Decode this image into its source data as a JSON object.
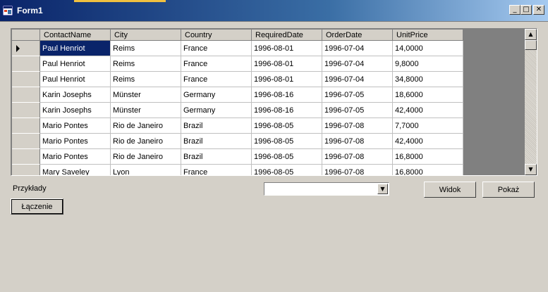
{
  "window": {
    "title": "Form1",
    "controls": {
      "minimize": "_",
      "maximize": "□",
      "close": "✕"
    },
    "icons": {
      "app": "form-app-icon"
    }
  },
  "grid": {
    "columns": [
      "ContactName",
      "City",
      "Country",
      "RequiredDate",
      "OrderDate",
      "UnitPrice"
    ],
    "rows": [
      [
        "Paul Henriot",
        "Reims",
        "France",
        "1996-08-01",
        "1996-07-04",
        "14,0000"
      ],
      [
        "Paul Henriot",
        "Reims",
        "France",
        "1996-08-01",
        "1996-07-04",
        "9,8000"
      ],
      [
        "Paul Henriot",
        "Reims",
        "France",
        "1996-08-01",
        "1996-07-04",
        "34,8000"
      ],
      [
        "Karin Josephs",
        "Münster",
        "Germany",
        "1996-08-16",
        "1996-07-05",
        "18,6000"
      ],
      [
        "Karin Josephs",
        "Münster",
        "Germany",
        "1996-08-16",
        "1996-07-05",
        "42,4000"
      ],
      [
        "Mario Pontes",
        "Rio de Janeiro",
        "Brazil",
        "1996-08-05",
        "1996-07-08",
        "7,7000"
      ],
      [
        "Mario Pontes",
        "Rio de Janeiro",
        "Brazil",
        "1996-08-05",
        "1996-07-08",
        "42,4000"
      ],
      [
        "Mario Pontes",
        "Rio de Janeiro",
        "Brazil",
        "1996-08-05",
        "1996-07-08",
        "16,8000"
      ],
      [
        "Mary Saveley",
        "Lyon",
        "France",
        "1996-08-05",
        "1996-07-08",
        "16,8000"
      ]
    ],
    "current_row_index": 0,
    "selected_cell": {
      "row": 0,
      "column": 0
    }
  },
  "form": {
    "examples_label": "Przykłady",
    "examples_combo_value": "",
    "view_button": "Widok",
    "show_button": "Pokaż",
    "join_button": "Łączenie"
  },
  "colors": {
    "title_gradient_start": "#0a246a",
    "title_gradient_end": "#a6caf0",
    "selection": "#0a246a",
    "control_face": "#d4d0c8",
    "grid_background": "#808080"
  }
}
